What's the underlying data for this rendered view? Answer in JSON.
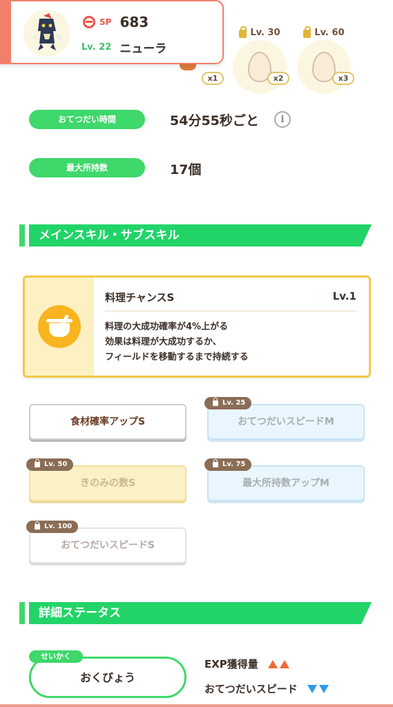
{
  "header": {
    "sp_label": "SP",
    "sp_value": "683",
    "level": "Lv. 22",
    "name": "ニューラ",
    "accent_color": "#f27f6a",
    "eggs": [
      {
        "lock_level": "Lv. 30",
        "multiplier": "x2"
      },
      {
        "lock_level": "Lv. 60",
        "multiplier": "x3"
      }
    ],
    "first_multiplier": "x1"
  },
  "stats": {
    "help_time_label": "おてつだい時間",
    "help_time_value": "54分55秒ごと",
    "max_carry_label": "最大所持数",
    "max_carry_value": "17個"
  },
  "skills_section": {
    "title": "メインスキル・サブスキル",
    "main_skill": {
      "name": "料理チャンスS",
      "level": "Lv.1",
      "description": [
        "料理の大成功確率が4%上がる",
        "効果は料理が大成功するか、",
        "フィールドを移動するまで持続する"
      ]
    },
    "sub_skills": [
      {
        "name": "食材確率アップS",
        "lock": ""
      },
      {
        "name": "おてつだいスピードM",
        "lock": "Lv. 25"
      },
      {
        "name": "きのみの数S",
        "lock": "Lv. 50"
      },
      {
        "name": "最大所持数アップM",
        "lock": "Lv. 75"
      },
      {
        "name": "おてつだいスピードS",
        "lock": "Lv. 100"
      }
    ]
  },
  "details_section": {
    "title": "詳細ステータス",
    "nature_tag": "せいかく",
    "nature": "おくびょう",
    "effects": [
      {
        "label": "EXP獲得量",
        "direction": "up",
        "color": "#f36a3a"
      },
      {
        "label": "おてつだいスピード",
        "direction": "down",
        "color": "#2f9be8"
      }
    ]
  },
  "colors": {
    "primary_green": "#3ed86b",
    "skill_gold": "#f4c746"
  }
}
